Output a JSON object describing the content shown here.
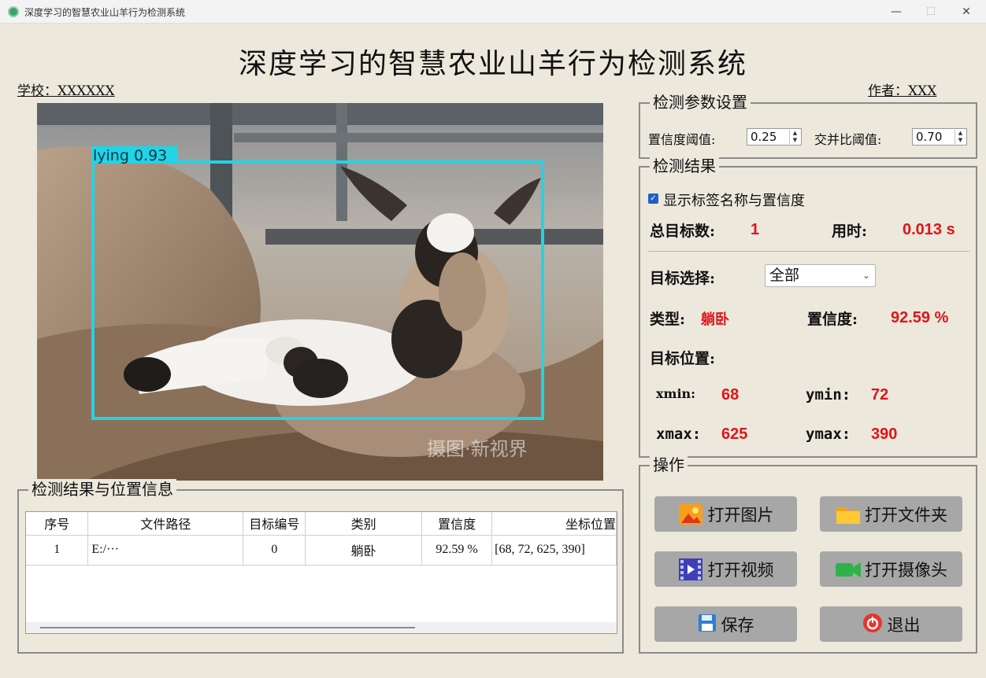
{
  "window": {
    "title": "深度学习的智慧农业山羊行为检测系统",
    "minimize": "—",
    "maximize": "☐",
    "close": "✕"
  },
  "header": {
    "title": "深度学习的智慧农业山羊行为检测系统",
    "school": "学校：XXXXXX",
    "author": "作者：XXX"
  },
  "image": {
    "detection_label": "lying 0.93",
    "watermark": "摄图·新视界",
    "box_color": "#23d3e6"
  },
  "params": {
    "title": "检测参数设置",
    "conf_label": "置信度阈值:",
    "conf_value": "0.25",
    "iou_label": "交并比阈值:",
    "iou_value": "0.70"
  },
  "results": {
    "title": "检测结果",
    "show_label_text": "显示标签名称与置信度",
    "show_label_checked": true,
    "total_label": "总目标数:",
    "total_value": "1",
    "time_label": "用时:",
    "time_value": "0.013 s",
    "target_select_label": "目标选择:",
    "target_select_value": "全部",
    "type_label": "类型:",
    "type_value": "躺卧",
    "conf_label": "置信度:",
    "conf_value": "92.59 %",
    "position_label": "目标位置:",
    "xmin_label": "xmin:",
    "xmin_value": "68",
    "ymin_label": "ymin:",
    "ymin_value": "72",
    "xmax_label": "xmax:",
    "xmax_value": "625",
    "ymax_label": "ymax:",
    "ymax_value": "390",
    "accent_color": "#e0141a"
  },
  "operations": {
    "title": "操作",
    "open_image": "打开图片",
    "open_folder": "打开文件夹",
    "open_video": "打开视频",
    "open_camera": "打开摄像头",
    "save": "保存",
    "exit": "退出"
  },
  "table": {
    "title": "检测结果与位置信息",
    "columns": [
      "序号",
      "文件路径",
      "目标编号",
      "类别",
      "置信度",
      "坐标位置"
    ],
    "rows": [
      [
        "1",
        "E:/···",
        "0",
        "躺卧",
        "92.59 %",
        "[68, 72, 625, 390]"
      ]
    ]
  }
}
